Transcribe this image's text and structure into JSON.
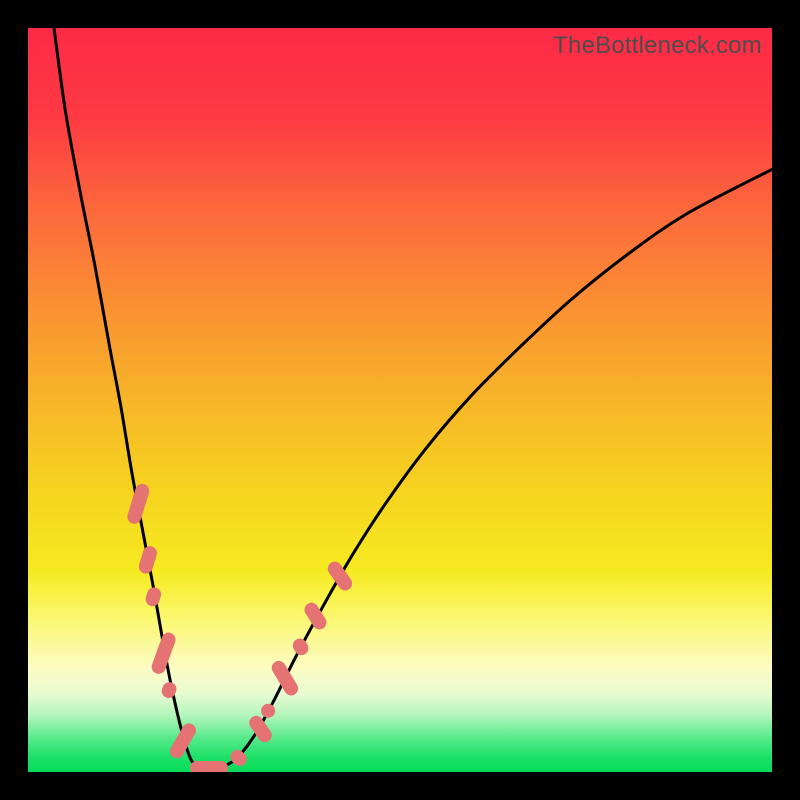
{
  "attribution": "TheBottleneck.com",
  "colors": {
    "black": "#000000",
    "curve": "#000000",
    "marker": "#e57373",
    "gradient_stops": [
      {
        "offset": 0.0,
        "color": "#fd2a46"
      },
      {
        "offset": 0.12,
        "color": "#fd3a43"
      },
      {
        "offset": 0.25,
        "color": "#fc6a3c"
      },
      {
        "offset": 0.38,
        "color": "#fa9232"
      },
      {
        "offset": 0.5,
        "color": "#f7b528"
      },
      {
        "offset": 0.62,
        "color": "#f6d31f"
      },
      {
        "offset": 0.73,
        "color": "#f6ea21"
      },
      {
        "offset": 0.78,
        "color": "#faf65e"
      },
      {
        "offset": 0.82,
        "color": "#fbf992"
      },
      {
        "offset": 0.86,
        "color": "#fcfcc3"
      },
      {
        "offset": 0.895,
        "color": "#e8fbd3"
      },
      {
        "offset": 0.925,
        "color": "#b0f5b9"
      },
      {
        "offset": 0.955,
        "color": "#55e989"
      },
      {
        "offset": 0.98,
        "color": "#1de169"
      },
      {
        "offset": 1.0,
        "color": "#06db58"
      }
    ]
  },
  "chart_data": {
    "type": "line",
    "title": "",
    "xlabel": "",
    "ylabel": "",
    "xlim": [
      0,
      100
    ],
    "ylim": [
      0,
      100
    ],
    "grid": false,
    "series": [
      {
        "name": "bottleneck-curve",
        "x": [
          3.5,
          5,
          7,
          9,
          11,
          12.5,
          14,
          15.5,
          17,
          18.4,
          19.6,
          20.8,
          22,
          23.5,
          25.5,
          28,
          30.5,
          33,
          36,
          39.5,
          43.5,
          48,
          53.5,
          59.5,
          66,
          73,
          80.5,
          88.5,
          100
        ],
        "y": [
          100,
          89,
          78,
          68,
          57,
          49,
          40,
          32,
          24,
          16,
          10,
          5,
          1.5,
          0.5,
          0.5,
          1.8,
          5,
          9.5,
          15.5,
          22,
          29,
          36,
          43.5,
          50.5,
          57,
          63.5,
          69.5,
          75,
          81
        ]
      }
    ],
    "markers": [
      {
        "x": 14.8,
        "y": 36.0,
        "len": 7.0,
        "angle": -73
      },
      {
        "x": 16.1,
        "y": 28.5,
        "len": 4.8,
        "angle": -73
      },
      {
        "x": 16.9,
        "y": 23.5,
        "len": 3.2,
        "angle": -73
      },
      {
        "x": 18.2,
        "y": 16.0,
        "len": 7.5,
        "angle": -70
      },
      {
        "x": 19.0,
        "y": 11.0,
        "len": 2.8,
        "angle": -68
      },
      {
        "x": 20.8,
        "y": 4.2,
        "len": 6.5,
        "angle": -60
      },
      {
        "x": 24.3,
        "y": 0.6,
        "len": 6.5,
        "angle": 0
      },
      {
        "x": 28.3,
        "y": 1.9,
        "len": 3.0,
        "angle": 40
      },
      {
        "x": 31.2,
        "y": 5.8,
        "len": 5.0,
        "angle": 55
      },
      {
        "x": 32.3,
        "y": 8.2,
        "len": 2.5,
        "angle": 57
      },
      {
        "x": 34.5,
        "y": 12.7,
        "len": 6.5,
        "angle": 59
      },
      {
        "x": 36.6,
        "y": 16.8,
        "len": 3.0,
        "angle": 60
      },
      {
        "x": 38.7,
        "y": 21.0,
        "len": 5.0,
        "angle": 58
      },
      {
        "x": 41.9,
        "y": 26.3,
        "len": 5.5,
        "angle": 55
      }
    ]
  }
}
